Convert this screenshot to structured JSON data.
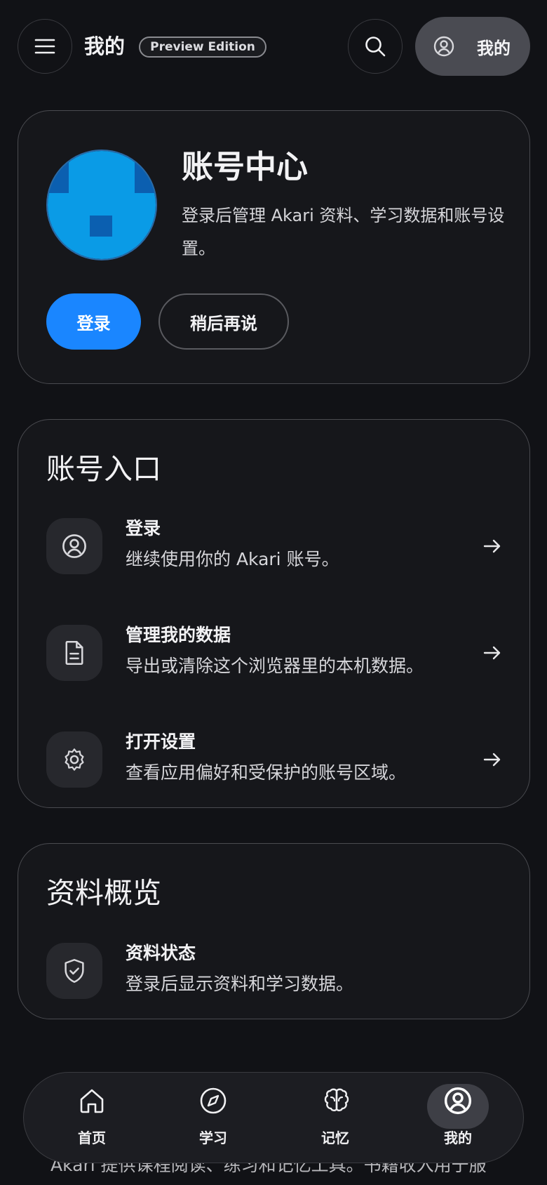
{
  "header": {
    "title": "我的",
    "edition_badge": "Preview Edition",
    "profile_label": "我的"
  },
  "account_card": {
    "title": "账号中心",
    "description": "登录后管理 Akari 资料、学习数据和账号设置。",
    "login_button": "登录",
    "later_button": "稍后再说"
  },
  "entry_section": {
    "title": "账号入口",
    "items": [
      {
        "title": "登录",
        "subtitle": "继续使用你的 Akari 账号。",
        "icon": "user-icon"
      },
      {
        "title": "管理我的数据",
        "subtitle": "导出或清除这个浏览器里的本机数据。",
        "icon": "document-icon"
      },
      {
        "title": "打开设置",
        "subtitle": "查看应用偏好和受保护的账号区域。",
        "icon": "gear-icon"
      }
    ]
  },
  "overview_section": {
    "title": "资料概览",
    "items": [
      {
        "title": "资料状态",
        "subtitle": "登录后显示资料和学习数据。",
        "icon": "shield-check-icon"
      }
    ]
  },
  "footer": {
    "text": "Akari 提供课程阅读、练习和记忆工具。书籍收入用于服"
  },
  "bottom_nav": {
    "items": [
      {
        "label": "首页",
        "icon": "home-icon",
        "active": false
      },
      {
        "label": "学习",
        "icon": "compass-icon",
        "active": false
      },
      {
        "label": "记忆",
        "icon": "brain-icon",
        "active": false
      },
      {
        "label": "我的",
        "icon": "user-icon",
        "active": true
      }
    ]
  },
  "colors": {
    "background": "#111216",
    "card": "#16171b",
    "accent": "#1a86ff",
    "avatar_main": "#0a9be6",
    "avatar_block": "#0b5fb0"
  }
}
